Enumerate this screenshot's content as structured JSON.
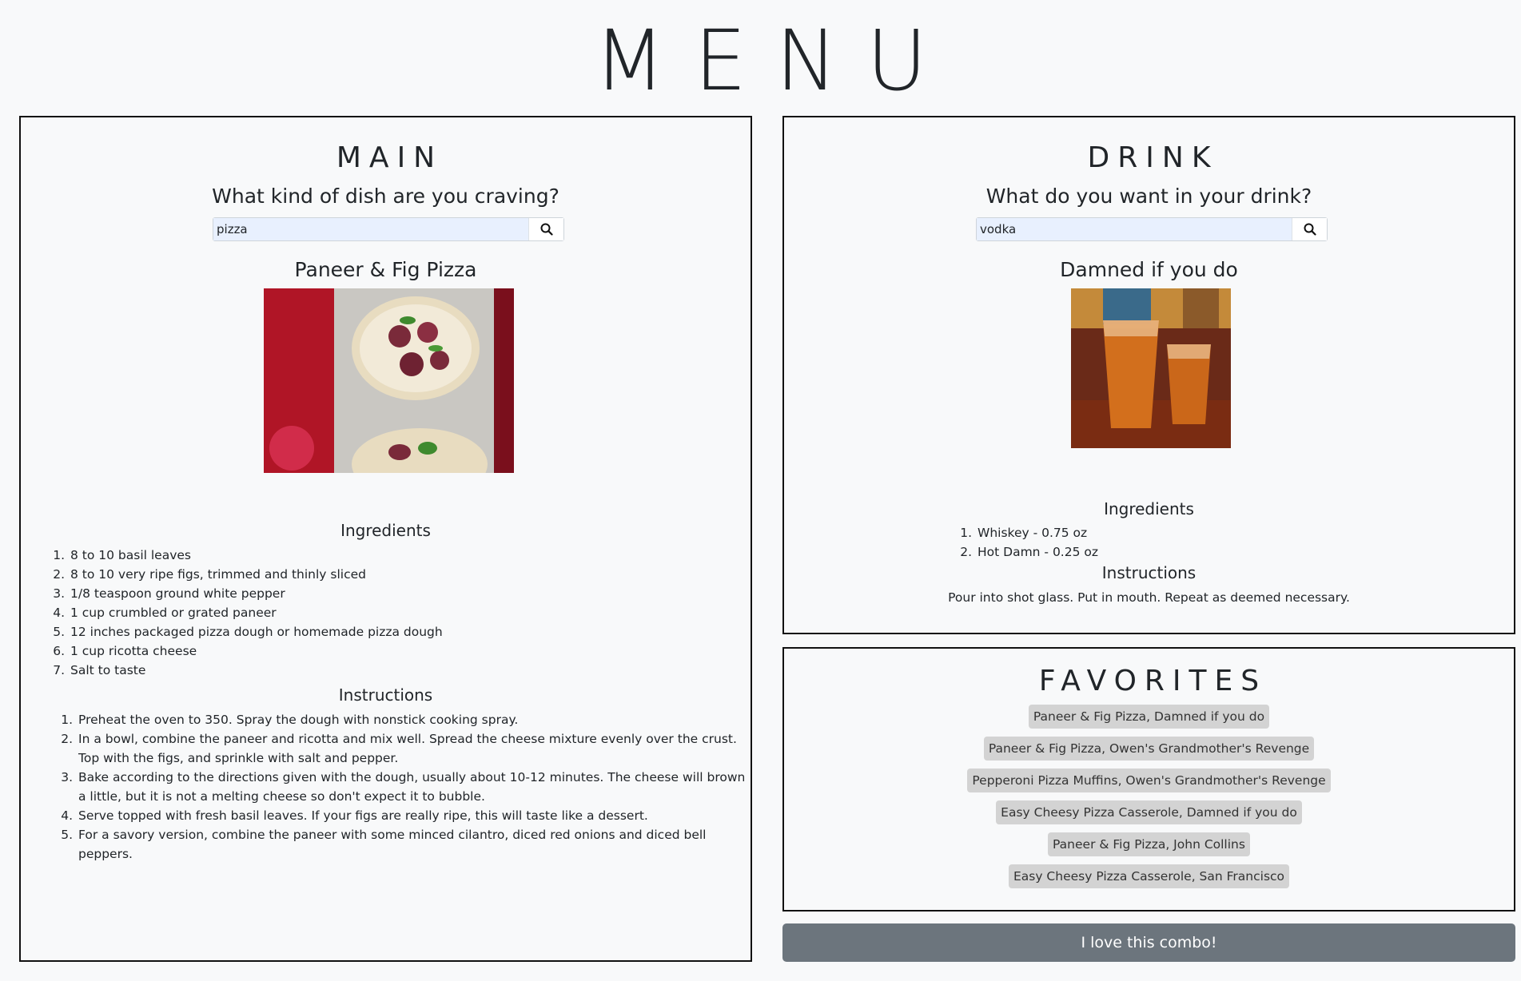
{
  "page": {
    "title": "MENU"
  },
  "main": {
    "heading": "MAIN",
    "prompt": "What kind of dish are you craving?",
    "search": {
      "value": "pizza",
      "placeholder": ""
    },
    "recipe": {
      "title": "Paneer & Fig Pizza",
      "ingredients_heading": "Ingredients",
      "ingredients": [
        "8 to 10 basil leaves",
        "8 to 10 very ripe figs, trimmed and thinly sliced",
        "1/8 teaspoon ground white pepper",
        "1 cup crumbled or grated paneer",
        "12 inches packaged pizza dough or homemade pizza dough",
        "1 cup ricotta cheese",
        "Salt to taste"
      ],
      "instructions_heading": "Instructions",
      "instructions": [
        "Preheat the oven to 350. Spray the dough with nonstick cooking spray.",
        "In a bowl, combine the paneer and ricotta and mix well. Spread the cheese mixture evenly over the crust. Top with the figs, and sprinkle with salt and pepper.",
        "Bake according to the directions given with the dough, usually about 10-12 minutes. The cheese will brown a little, but it is not a melting cheese so don't expect it to bubble.",
        "Serve topped with fresh basil leaves. If your figs are really ripe, this will taste like a dessert.",
        "For a savory version, combine the paneer with some minced cilantro, diced red onions and diced bell peppers."
      ]
    }
  },
  "drink": {
    "heading": "DRINK",
    "prompt": "What do you want in your drink?",
    "search": {
      "value": "vodka",
      "placeholder": ""
    },
    "recipe": {
      "title": "Damned if you do",
      "ingredients_heading": "Ingredients",
      "ingredients": [
        "Whiskey - 0.75 oz",
        "Hot Damn - 0.25 oz"
      ],
      "instructions_heading": "Instructions",
      "instructions": "Pour into shot glass. Put in mouth. Repeat as deemed necessary."
    }
  },
  "favorites": {
    "heading": "FAVORITES",
    "items": [
      "Paneer & Fig Pizza, Damned if you do",
      "Paneer & Fig Pizza, Owen's Grandmother's Revenge",
      "Pepperoni Pizza Muffins, Owen's Grandmother's Revenge",
      "Easy Cheesy Pizza Casserole, Damned if you do",
      "Paneer & Fig Pizza, John Collins",
      "Easy Cheesy Pizza Casserole, San Francisco"
    ]
  },
  "actions": {
    "love_label": "I love this combo!"
  },
  "icons": {
    "search": "search-icon"
  }
}
